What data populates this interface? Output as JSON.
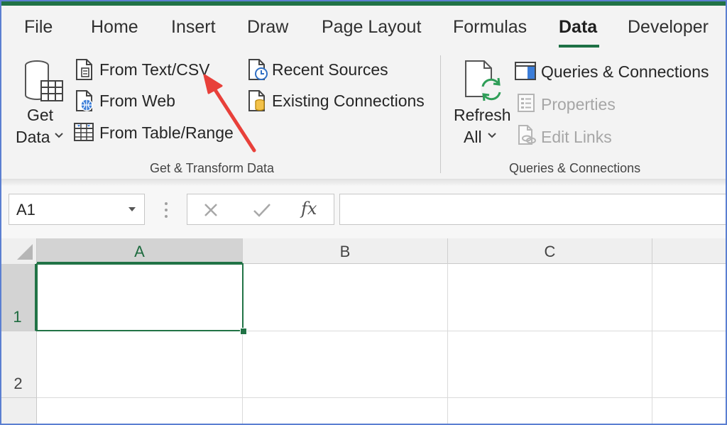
{
  "tabs": [
    {
      "label": "File",
      "active": false
    },
    {
      "label": "Home",
      "active": false
    },
    {
      "label": "Insert",
      "active": false
    },
    {
      "label": "Draw",
      "active": false
    },
    {
      "label": "Page Layout",
      "active": false
    },
    {
      "label": "Formulas",
      "active": false
    },
    {
      "label": "Data",
      "active": true
    },
    {
      "label": "Developer",
      "active": false
    }
  ],
  "get_transform": {
    "get_data_line1": "Get",
    "get_data_line2": "Data",
    "from_text_csv": "From Text/CSV",
    "from_web": "From Web",
    "from_table_range": "From Table/Range",
    "recent_sources": "Recent Sources",
    "existing_connections": "Existing Connections",
    "group_label": "Get & Transform Data"
  },
  "queries": {
    "refresh_line1": "Refresh",
    "refresh_line2": "All",
    "queries_connections": "Queries & Connections",
    "properties": "Properties",
    "edit_links": "Edit Links",
    "group_label": "Queries & Connections"
  },
  "formula_bar": {
    "name_box": "A1",
    "fx": "fx",
    "formula": ""
  },
  "grid": {
    "columns": [
      "A",
      "B",
      "C"
    ],
    "rows": [
      "1",
      "2"
    ]
  },
  "colors": {
    "accent": "#217346",
    "annotation_arrow": "#e8403a"
  }
}
